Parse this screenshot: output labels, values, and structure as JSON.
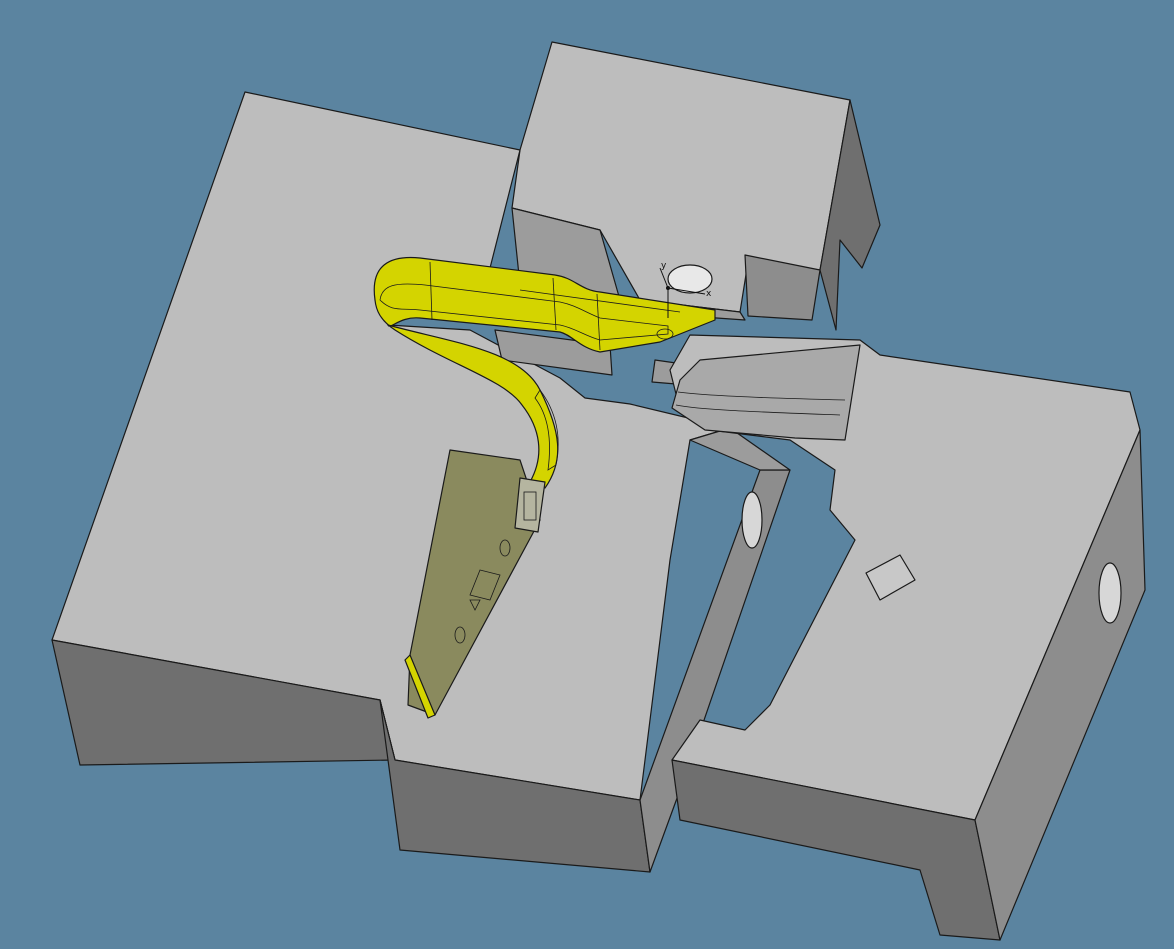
{
  "viewport": {
    "background_color": "#5b84a0",
    "content": "3D CAD model"
  },
  "colors": {
    "top_face": "#bdbdbd",
    "side_face_light": "#9c9c9c",
    "side_face_dark": "#6f6f6f",
    "flex_yellow": "#d4d400",
    "flex_red": "#c8585a",
    "pcb_olive": "#8a8a5e"
  },
  "axis_triad": {
    "x_label": "x",
    "y_label": "y"
  }
}
